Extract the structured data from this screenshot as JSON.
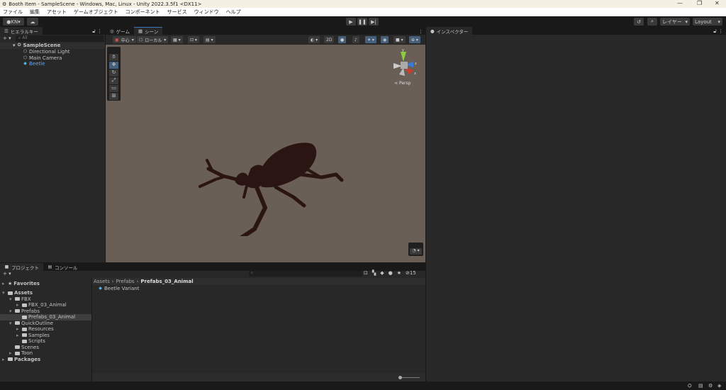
{
  "window": {
    "title": "Booth Item - SampleScene - Windows, Mac, Linux - Unity 2022.3.5f1 <DX11>",
    "controls": [
      "—",
      "❐",
      "✕"
    ]
  },
  "menu": [
    "ファイル",
    "編集",
    "アセット",
    "ゲームオブジェクト",
    "コンポーネント",
    "サービス",
    "ウィンドウ",
    "ヘルプ"
  ],
  "toolbar": {
    "account": "KN",
    "layers": "レイヤー",
    "layout": "Layout"
  },
  "hierarchy": {
    "tab": "ヒエラルキー",
    "search_placeholder": "All",
    "scene": "SampleScene",
    "items": [
      "Directional Light",
      "Main Camera",
      "Beetle"
    ]
  },
  "scene": {
    "tabs": [
      "ゲーム",
      "シーン"
    ],
    "pivot": "中心",
    "space": "ローカル",
    "mode_2d": "2D",
    "persp": "Persp",
    "axes": {
      "y": "y",
      "z": "z",
      "x": "x"
    }
  },
  "inspector": {
    "tab": "インスペクター"
  },
  "project": {
    "tabs": [
      "プロジェクト",
      "コンソール"
    ],
    "hidden_count": "15",
    "tree": [
      {
        "label": "Favorites",
        "bold": true,
        "depth": 0,
        "arrow": "▸",
        "icon": "star"
      },
      {
        "label": "Assets",
        "bold": true,
        "depth": 0,
        "arrow": "▾",
        "icon": "folder"
      },
      {
        "label": "FBX",
        "depth": 1,
        "arrow": "▾",
        "icon": "folder"
      },
      {
        "label": "FBX_03_Animal",
        "depth": 2,
        "arrow": "▸",
        "icon": "folder"
      },
      {
        "label": "Prefabs",
        "depth": 1,
        "arrow": "▾",
        "icon": "folder"
      },
      {
        "label": "Prefabs_03_Animal",
        "depth": 2,
        "arrow": "",
        "icon": "folder",
        "selected": true
      },
      {
        "label": "QuickOutline",
        "depth": 1,
        "arrow": "▾",
        "icon": "folder"
      },
      {
        "label": "Resources",
        "depth": 2,
        "arrow": "▸",
        "icon": "folder"
      },
      {
        "label": "Samples",
        "depth": 2,
        "arrow": "▸",
        "icon": "folder"
      },
      {
        "label": "Scripts",
        "depth": 2,
        "arrow": "",
        "icon": "folder"
      },
      {
        "label": "Scenes",
        "depth": 1,
        "arrow": "",
        "icon": "folder"
      },
      {
        "label": "Toon",
        "depth": 1,
        "arrow": "▸",
        "icon": "folder"
      },
      {
        "label": "Packages",
        "bold": true,
        "depth": 0,
        "arrow": "▸",
        "icon": "folder"
      }
    ],
    "breadcrumb": [
      "Assets",
      "Prefabs",
      "Prefabs_03_Animal"
    ],
    "assets": [
      "Beetle Variant"
    ]
  }
}
